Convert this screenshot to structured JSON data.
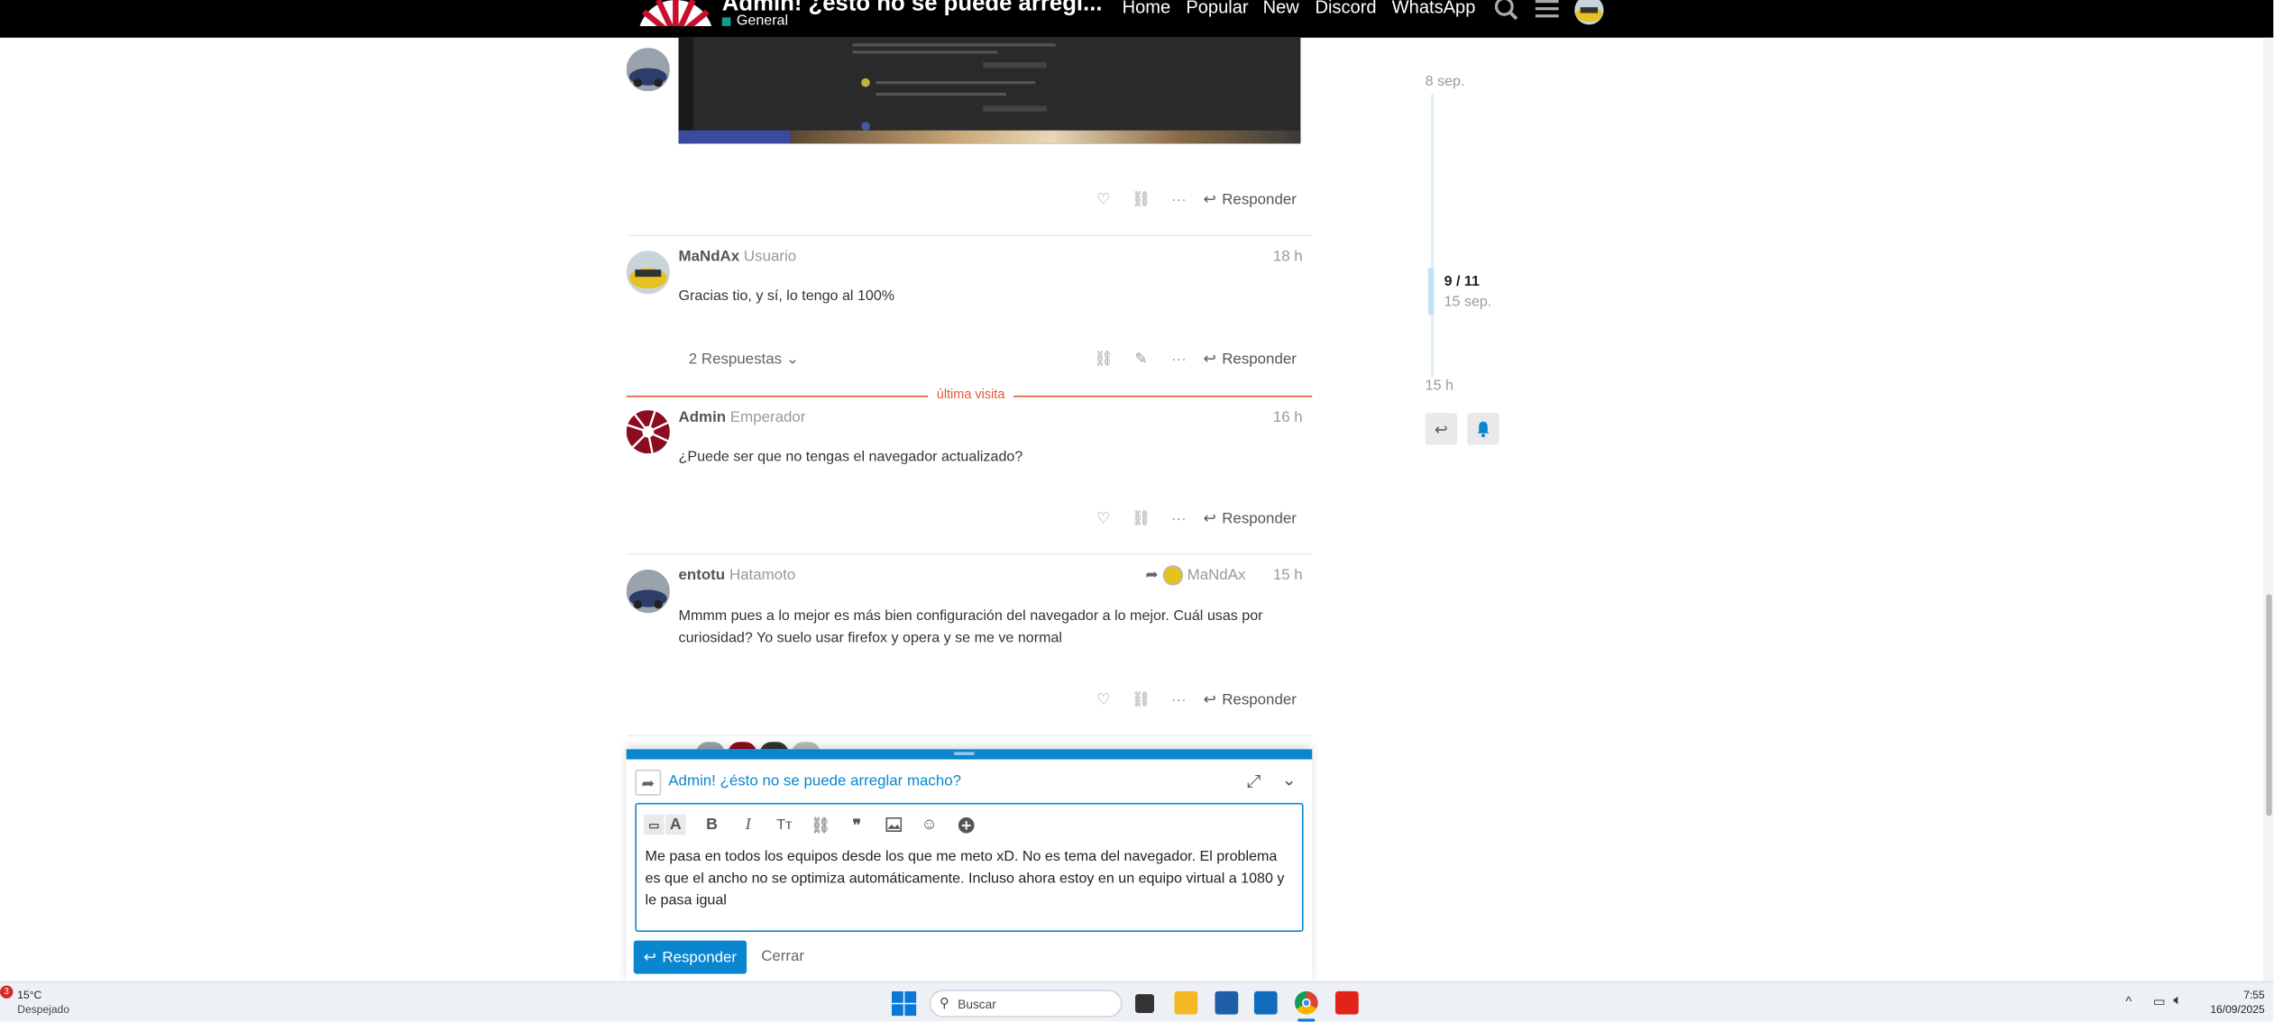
{
  "header": {
    "title": "Admin! ¿ésto no se puede arregl...",
    "category": "General",
    "nav": [
      "Home",
      "Popular",
      "New",
      "Discord",
      "WhatsApp"
    ]
  },
  "posts": [
    {
      "actions": {
        "reply": "Responder"
      }
    },
    {
      "username": "MaNdAx",
      "user_title": "Usuario",
      "time": "18 h",
      "body": "Gracias tio, y sí, lo tengo al 100%",
      "replies": "2 Respuestas",
      "actions": {
        "reply": "Responder"
      }
    },
    {
      "username": "Admin",
      "user_title": "Emperador",
      "time": "16 h",
      "body": "¿Puede ser que no tengas el navegador actualizado?",
      "actions": {
        "reply": "Responder"
      }
    },
    {
      "username": "entotu",
      "user_title": "Hatamoto",
      "reply_to": "MaNdAx",
      "time": "15 h",
      "body": "Mmmm pues a lo mejor es más bien configuración del navegador a lo mejor. Cuál usas por curiosidad? Yo suelo usar firefox y opera y se me ve normal",
      "actions": {
        "reply": "Responder"
      }
    }
  ],
  "last_visit": "última visita",
  "timeline": {
    "start": "8 sep.",
    "position": "9 / 11",
    "position_date": "15 sep.",
    "end": "15 h"
  },
  "composer": {
    "topic_title": "Admin! ¿ésto no se puede arreglar macho?",
    "text": "Me pasa en todos los equipos desde los que me meto xD. No es tema del navegador. El problema es que el ancho no se optimiza automáticamente. Incluso ahora estoy en un equipo virtual a 1080 y le pasa igual",
    "submit": "Responder",
    "cancel": "Cerrar"
  },
  "taskbar": {
    "weather_temp": "15°C",
    "weather_desc": "Despejado",
    "weather_badge": "3",
    "search_placeholder": "Buscar",
    "time": "7:55",
    "date": "16/09/2025"
  },
  "colors": {
    "accent": "#0a86d1",
    "header_bg": "#000000",
    "last_visit": "#e45735"
  }
}
